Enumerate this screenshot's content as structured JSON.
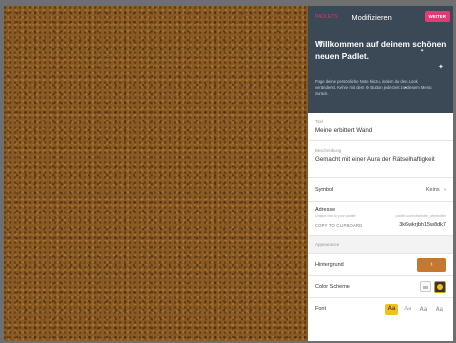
{
  "panel": {
    "tab_home": "PADLETS",
    "tab_title": "Modifizieren",
    "next_label": "WEITER",
    "welcome_title": "Willkommen auf deinem schönen neuen Padlet.",
    "welcome_text": "Füge deine persönliche Note hinzu, indem du den Look veränderst. Kehre mit dem ⚙ Button jederzeit zu diesem Menü zurück."
  },
  "fields": {
    "title_label": "Titel",
    "title_value": "Meine erbittert Wand",
    "description_label": "Beschreibung",
    "description_value": "Gemacht mit einer Aura der Rätselhaftigkeit"
  },
  "symbol": {
    "label": "Symbol",
    "value": "Keins",
    "chevron": "›"
  },
  "address": {
    "label": "Adresse",
    "hint": "Unique link to your padlet",
    "url": "padlet.com/charlotte_oberkofler",
    "copy_label": "COPY TO CLIPBOARD",
    "slug": "3k6wkrjbh15w8dk7"
  },
  "appearance": {
    "section_title": "Appearance",
    "background_label": "Hintergrund",
    "background_color": "#c7782f",
    "background_chevron": "›",
    "color_scheme_label": "Color Scheme",
    "font_label": "Font",
    "font_options": [
      "Aa",
      "Aa",
      "Aa",
      "Aa"
    ]
  },
  "colors": {
    "board": "#8a5a24",
    "panel_header": "#3b4856",
    "accent": "#e23a72"
  }
}
